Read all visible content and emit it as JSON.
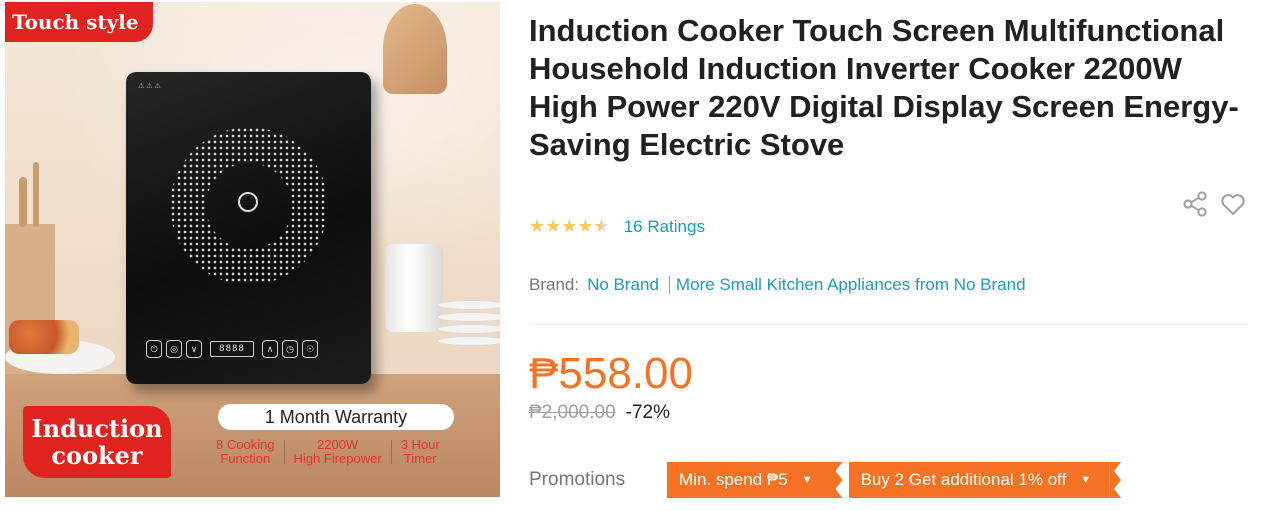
{
  "image": {
    "badge_top": "Touch style",
    "badge_main_line1": "Induction",
    "badge_main_line2": "cooker",
    "warranty": "1 Month Warranty",
    "features": [
      {
        "line1": "8 Cooking",
        "line2": "Function"
      },
      {
        "line1": "2200W",
        "line2": "High Firepower"
      },
      {
        "line1": "3 Hour",
        "line2": "Timer"
      }
    ]
  },
  "product": {
    "title": "Induction Cooker Touch Screen Multifunctional Household Induction Inverter Cooker 2200W High Power 220V Digital Display Screen Energy-Saving Electric Stove",
    "rating_value": 4.5,
    "ratings_text": "16 Ratings",
    "brand_label": "Brand:",
    "brand_name": "No Brand",
    "brand_more": "More Small Kitchen Appliances from No Brand",
    "price": "₱558.00",
    "original_price": "₱2,000.00",
    "discount": "-72%",
    "promotions_label": "Promotions",
    "vouchers": [
      "Min. spend ₱5",
      "Buy 2 Get additional 1% off"
    ]
  },
  "colors": {
    "accent": "#f57224",
    "link": "#1a9cb7",
    "badge_red": "#e0231e",
    "star": "#faca51"
  },
  "icons": [
    "share-icon",
    "heart-icon",
    "star-icon",
    "caret-down-icon"
  ]
}
